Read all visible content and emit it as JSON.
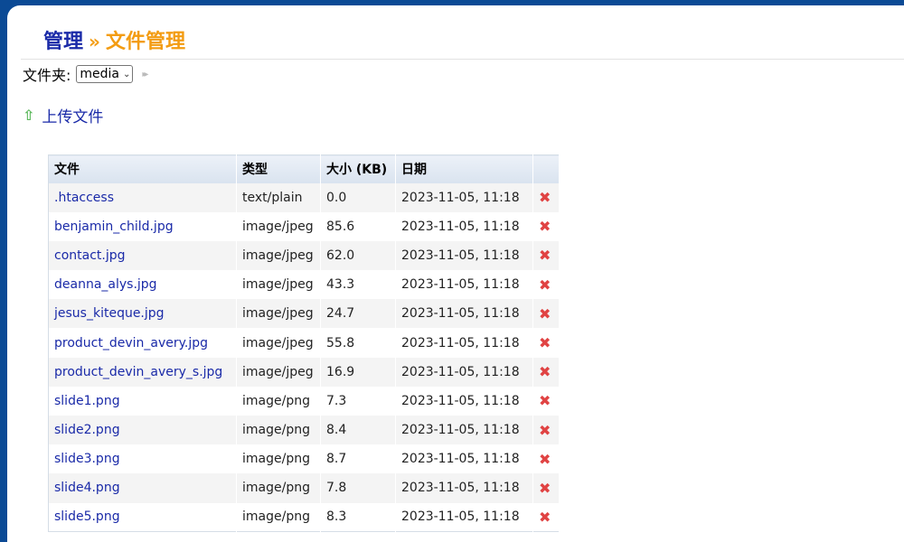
{
  "breadcrumb": {
    "parent": "管理",
    "separator": "»",
    "current": "文件管理"
  },
  "folder": {
    "label": "文件夹:",
    "selected": "media",
    "go_glyph": "▸▸"
  },
  "upload": {
    "icon": "up-arrow-icon",
    "label": "上传文件"
  },
  "table": {
    "headers": {
      "file": "文件",
      "type": "类型",
      "size": "大小 (KB)",
      "date": "日期"
    },
    "rows": [
      {
        "name": ".htaccess",
        "type": "text/plain",
        "size": "0.0",
        "date": "2023-11-05, 11:18"
      },
      {
        "name": "benjamin_child.jpg",
        "type": "image/jpeg",
        "size": "85.6",
        "date": "2023-11-05, 11:18"
      },
      {
        "name": "contact.jpg",
        "type": "image/jpeg",
        "size": "62.0",
        "date": "2023-11-05, 11:18"
      },
      {
        "name": "deanna_alys.jpg",
        "type": "image/jpeg",
        "size": "43.3",
        "date": "2023-11-05, 11:18"
      },
      {
        "name": "jesus_kiteque.jpg",
        "type": "image/jpeg",
        "size": "24.7",
        "date": "2023-11-05, 11:18"
      },
      {
        "name": "product_devin_avery.jpg",
        "type": "image/jpeg",
        "size": "55.8",
        "date": "2023-11-05, 11:18"
      },
      {
        "name": "product_devin_avery_s.jpg",
        "type": "image/jpeg",
        "size": "16.9",
        "date": "2023-11-05, 11:18"
      },
      {
        "name": "slide1.png",
        "type": "image/png",
        "size": "7.3",
        "date": "2023-11-05, 11:18"
      },
      {
        "name": "slide2.png",
        "type": "image/png",
        "size": "8.4",
        "date": "2023-11-05, 11:18"
      },
      {
        "name": "slide3.png",
        "type": "image/png",
        "size": "8.7",
        "date": "2023-11-05, 11:18"
      },
      {
        "name": "slide4.png",
        "type": "image/png",
        "size": "7.8",
        "date": "2023-11-05, 11:18"
      },
      {
        "name": "slide5.png",
        "type": "image/png",
        "size": "8.3",
        "date": "2023-11-05, 11:18"
      }
    ]
  },
  "colors": {
    "header_bg": "#0b4a95",
    "link": "#1a2aa8",
    "accent": "#f39c12",
    "delete": "#e04343",
    "upload_icon": "#5cb85c"
  }
}
